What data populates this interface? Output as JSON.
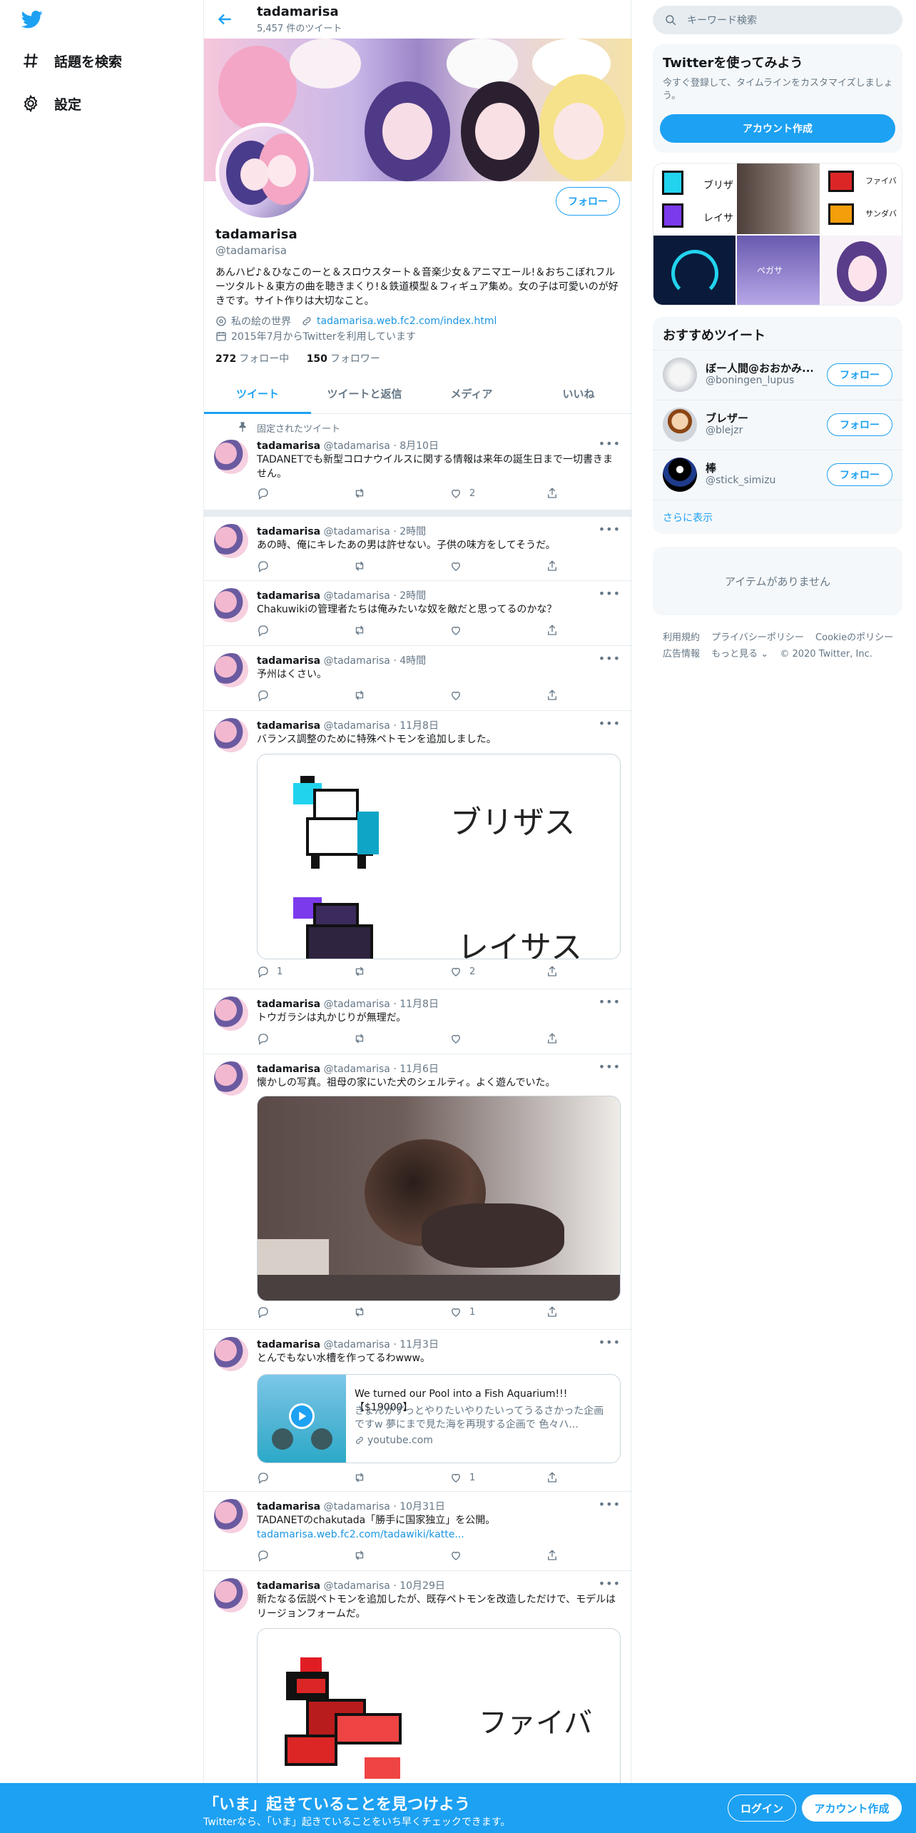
{
  "nav": {
    "explore_label": "話題を検索",
    "settings_label": "設定"
  },
  "header": {
    "name": "tadamarisa",
    "tweet_count": "5,457 件のツイート"
  },
  "profile": {
    "follow_label": "フォロー",
    "display_name": "tadamarisa",
    "handle": "@tadamarisa",
    "bio": "あんハピ♪＆ひなこのーと＆スロウスタート＆音楽少女＆アニマエール!＆おちこぼれフルーツタルト＆東方の曲を聴きまくり!＆鉄道模型＆フィギュア集め。女の子は可愛いのが好きです。サイト作りは大切なこと。",
    "location": "私の絵の世界",
    "url": "tadamarisa.web.fc2.com/index.html",
    "joined": "2015年7月からTwitterを利用しています",
    "following_count": "272",
    "following_label": "フォロー中",
    "followers_count": "150",
    "followers_label": "フォロワー"
  },
  "tabs": [
    "ツイート",
    "ツイートと返信",
    "メディア",
    "いいね"
  ],
  "pinned_label": "固定されたツイート",
  "tweets": [
    {
      "name": "tadamarisa",
      "handle": "@tadamarisa",
      "time": "8月10日",
      "text": "TADANETでも新型コロナウイルスに関する情報は来年の誕生日まで一切書きません。",
      "replies": "",
      "retweets": "",
      "likes": "2"
    },
    {
      "name": "tadamarisa",
      "handle": "@tadamarisa",
      "time": "2時間",
      "text": "あの時、俺にキレたあの男は許せない。子供の味方をしてそうだ。",
      "replies": "",
      "retweets": "",
      "likes": ""
    },
    {
      "name": "tadamarisa",
      "handle": "@tadamarisa",
      "time": "2時間",
      "text": "Chakuwikiの管理者たちは俺みたいな奴を敵だと思ってるのかな？",
      "replies": "",
      "retweets": "",
      "likes": ""
    },
    {
      "name": "tadamarisa",
      "handle": "@tadamarisa",
      "time": "4時間",
      "text": "予州はくさい。",
      "replies": "",
      "retweets": "",
      "likes": ""
    },
    {
      "name": "tadamarisa",
      "handle": "@tadamarisa",
      "time": "11月8日",
      "text": "バランス調整のために特殊ペトモンを追加しました。",
      "replies": "1",
      "retweets": "",
      "likes": "2",
      "media_labels": [
        "ブリザス",
        "レイサス"
      ]
    },
    {
      "name": "tadamarisa",
      "handle": "@tadamarisa",
      "time": "11月8日",
      "text": "トウガラシは丸かじりが無理だ。",
      "replies": "",
      "retweets": "",
      "likes": ""
    },
    {
      "name": "tadamarisa",
      "handle": "@tadamarisa",
      "time": "11月6日",
      "text": "懐かしの写真。祖母の家にいた犬のシェルティ。よく遊んでいた。",
      "replies": "",
      "retweets": "",
      "likes": "1"
    },
    {
      "name": "tadamarisa",
      "handle": "@tadamarisa",
      "time": "11月3日",
      "text": "とんでもない水槽を作ってるわwww。",
      "replies": "",
      "retweets": "",
      "likes": "1",
      "card": {
        "title": "We turned our Pool into a Fish Aquarium!!!【$19000】",
        "desc": "きょんがずっとやりたいやりたいってうるさかった企画ですw 夢にまで見た海を再現する企画で 色々ハ...",
        "domain": "youtube.com"
      }
    },
    {
      "name": "tadamarisa",
      "handle": "@tadamarisa",
      "time": "10月31日",
      "text": "TADANETのchakutada「勝手に国家独立」を公開。",
      "link": "tadamarisa.web.fc2.com/tadawiki/katte...",
      "replies": "",
      "retweets": "",
      "likes": ""
    },
    {
      "name": "tadamarisa",
      "handle": "@tadamarisa",
      "time": "10月29日",
      "text": "新たなる伝説ペトモンを追加したが、既存ペトモンを改造しただけで、モデルはリージョンフォームだ。",
      "replies": "",
      "retweets": "",
      "likes": "",
      "media_labels": [
        "ファイバ"
      ]
    }
  ],
  "search": {
    "placeholder": "キーワード検索"
  },
  "signup_box": {
    "title": "Twitterを使ってみよう",
    "sub": "今すぐ登録して、タイムラインをカスタマイズしましょう。",
    "button": "アカウント作成"
  },
  "media_grid": {
    "labels": [
      "ブリザ",
      "レイサ",
      "ファイバ",
      "サンダバ",
      "ペガサ"
    ]
  },
  "recommended": {
    "title": "おすすめツイート",
    "follow_label": "フォロー",
    "users": [
      {
        "name": "ぼー人間@おおかみ...",
        "handle": "@boningen_lupus"
      },
      {
        "name": "ブレザー",
        "handle": "@blejzr"
      },
      {
        "name": "棒",
        "handle": "@stick_simizu"
      }
    ],
    "more": "さらに表示"
  },
  "empty_box": {
    "text": "アイテムがありません"
  },
  "footer": {
    "row1": [
      "利用規約",
      "プライバシーポリシー",
      "Cookieのポリシー"
    ],
    "row2": [
      "広告情報",
      "もっと見る ⌄",
      "© 2020 Twitter, Inc."
    ]
  },
  "bottom_bar": {
    "title": "「いま」起きていることを見つけよう",
    "sub": "Twitterなら、「いま」起きていることをいち早くチェックできます。",
    "login": "ログイン",
    "signup": "アカウント作成"
  },
  "colors": {
    "accent": "#1da1f2",
    "text": "#14171a",
    "muted": "#657786",
    "border": "#e6ecf0"
  }
}
